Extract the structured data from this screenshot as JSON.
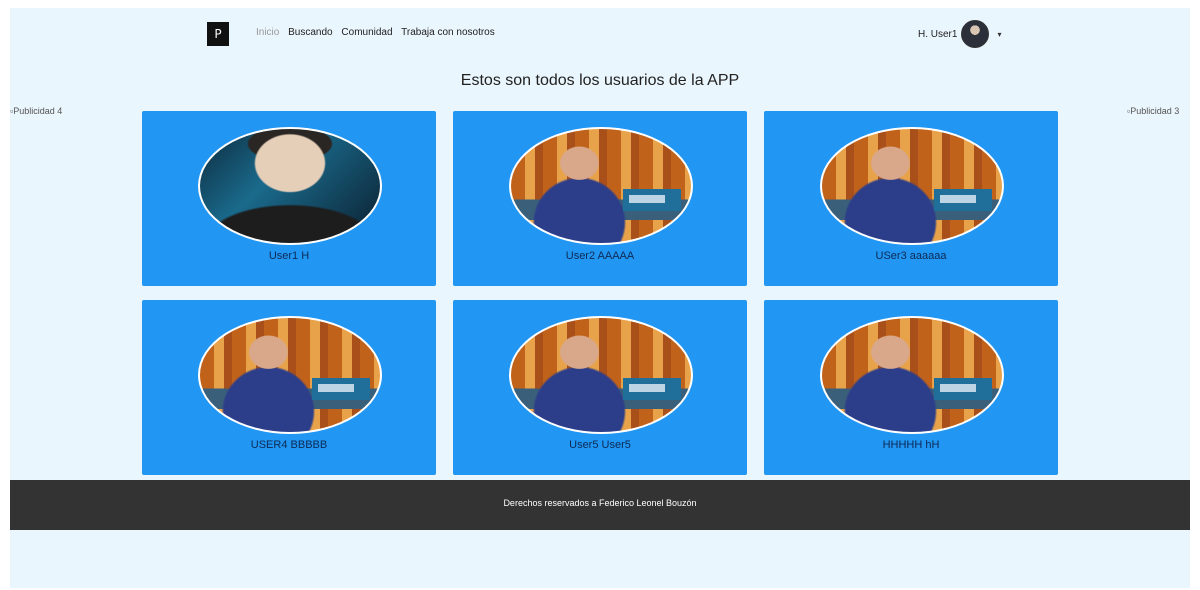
{
  "navbar": {
    "brand": "P",
    "links": [
      "Inicio",
      "Buscando",
      "Comunidad",
      "Trabaja con nosotros"
    ],
    "user_name": "H. User1",
    "caret": "▾"
  },
  "main": {
    "title": "Estos son todos los usuarios de la APP",
    "ad_left": "Publicidad 4",
    "ad_right": "Publicidad 3",
    "users": [
      {
        "name": "User1 H",
        "photo": "gamer"
      },
      {
        "name": "User2 AAAAA",
        "photo": "speaker"
      },
      {
        "name": "USer3 aaaaaa",
        "photo": "speaker"
      },
      {
        "name": "USER4 BBBBB",
        "photo": "speaker"
      },
      {
        "name": "User5 User5",
        "photo": "speaker"
      },
      {
        "name": "HHHHH hH",
        "photo": "speaker"
      }
    ]
  },
  "footer": {
    "text": "Derechos reservados a Federico Leonel Bouzón"
  },
  "colors": {
    "page_bg": "#eaf6fd",
    "card_bg": "#2196f3",
    "footer_bg": "#333333"
  }
}
